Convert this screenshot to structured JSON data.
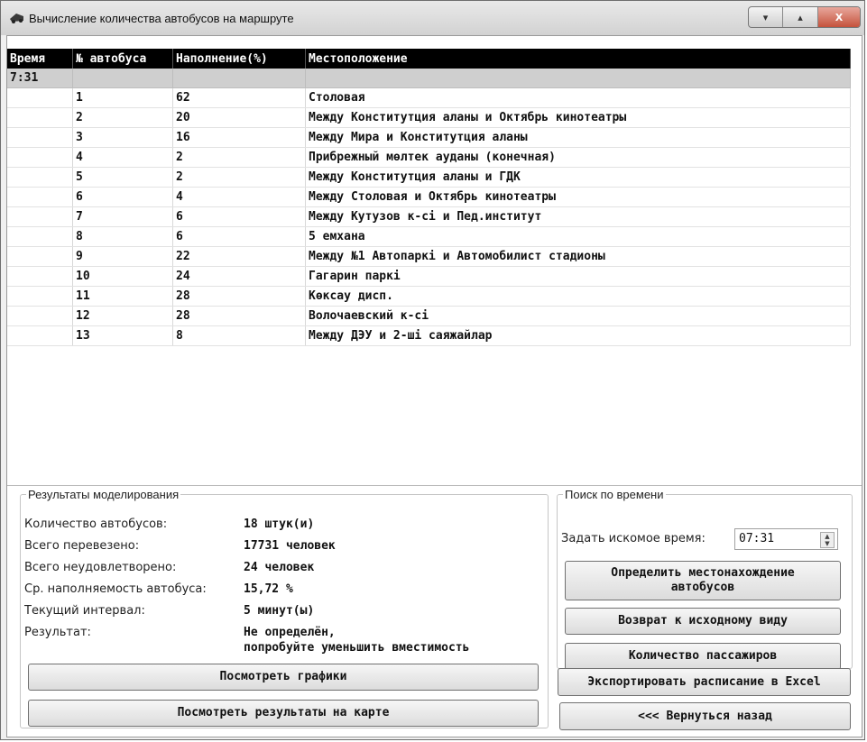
{
  "window": {
    "title": "Вычисление количества автобусов на маршруте",
    "controls": {
      "minimize": "▾",
      "maximize": "▴",
      "close": "X"
    }
  },
  "grid": {
    "columns": [
      "Время",
      "№ автобуса",
      "Наполнение(%)",
      "Местоположение"
    ],
    "group_time": "7:31",
    "rows": [
      {
        "bus": "1",
        "fill": "62",
        "location": "Столовая"
      },
      {
        "bus": "2",
        "fill": "20",
        "location": "Между Конститутция аланы и Октябрь кинотеатры"
      },
      {
        "bus": "3",
        "fill": "16",
        "location": "Между Мира и Конститутция аланы"
      },
      {
        "bus": "4",
        "fill": "2",
        "location": "Прибрежный мөлтек ауданы (конечная)"
      },
      {
        "bus": "5",
        "fill": "2",
        "location": "Между Конститутция аланы и ГДК"
      },
      {
        "bus": "6",
        "fill": "4",
        "location": "Между Столовая и Октябрь кинотеатры"
      },
      {
        "bus": "7",
        "fill": "6",
        "location": "Между Кутузов к-сі и Пед.институт"
      },
      {
        "bus": "8",
        "fill": "6",
        "location": "5 емхана"
      },
      {
        "bus": "9",
        "fill": "22",
        "location": "Между №1 Автопаркі и Автомобилист стадионы"
      },
      {
        "bus": "10",
        "fill": "24",
        "location": "Гагарин паркі"
      },
      {
        "bus": "11",
        "fill": "28",
        "location": "Көксау дисп."
      },
      {
        "bus": "12",
        "fill": "28",
        "location": "Волочаевский к-сі"
      },
      {
        "bus": "13",
        "fill": "8",
        "location": "Между ДЭУ и 2-ші саяжайлар"
      }
    ]
  },
  "results": {
    "legend": "Результаты моделирования",
    "bus_count_label": "Количество автобусов:",
    "bus_count_value": "18 штук(и)",
    "transported_label": "Всего перевезено:",
    "transported_value": "17731 человек",
    "unsatisfied_label": "Всего неудовлетворено:",
    "unsatisfied_value": "24 человек",
    "avg_fill_label": "Ср. наполняемость автобуса:",
    "avg_fill_value": "15,72 %",
    "interval_label": "Текущий интервал:",
    "interval_value": "5 минут(ы)",
    "result_label": "Результат:",
    "result_value_line1": "Не определён,",
    "result_value_line2": "попробуйте уменьшить вместимость",
    "charts_button": "Посмотреть графики",
    "map_button": "Посмотреть результаты на карте"
  },
  "search": {
    "legend": "Поиск по времени",
    "time_label": "Задать искомое время:",
    "time_value": "07:31",
    "locate_button_line1": "Определить местонахождение",
    "locate_button_line2": "автобусов",
    "reset_button": "Возврат к исходному виду",
    "passengers_button": "Количество пассажиров"
  },
  "export_button": "Экспортировать расписание в Excel",
  "back_button": "<<< Вернуться назад"
}
